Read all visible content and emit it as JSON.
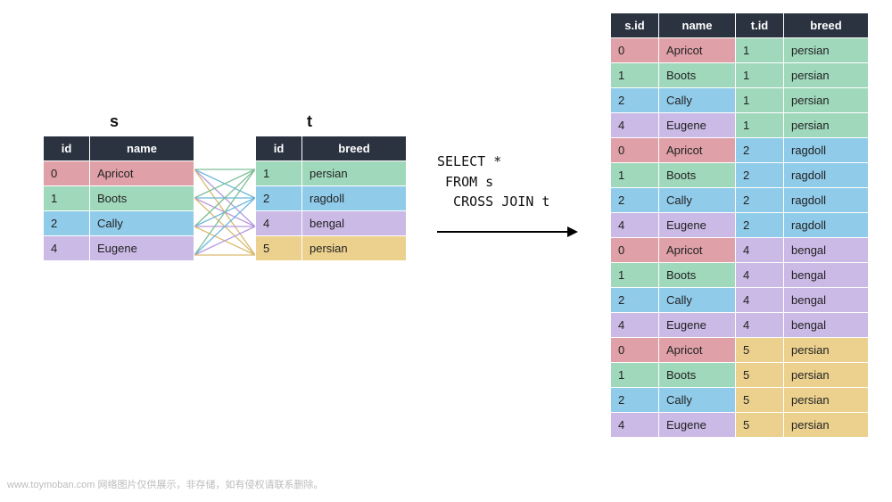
{
  "titles": {
    "s": "s",
    "t": "t"
  },
  "sql": "SELECT *\n FROM s\n  CROSS JOIN t",
  "watermark": "www.toymoban.com 网络图片仅供展示，非存储，如有侵权请联系删除。",
  "colors": {
    "header": "#2b3340",
    "red": "#dfa0a8",
    "green": "#a0d8bb",
    "blue": "#90cbea",
    "purple": "#cbb9e6",
    "yellow": "#ecd18e"
  },
  "table_s": {
    "headers": [
      "id",
      "name"
    ],
    "rows": [
      {
        "id": "0",
        "name": "Apricot",
        "color": "red"
      },
      {
        "id": "1",
        "name": "Boots",
        "color": "green"
      },
      {
        "id": "2",
        "name": "Cally",
        "color": "blue"
      },
      {
        "id": "4",
        "name": "Eugene",
        "color": "purple"
      }
    ]
  },
  "table_t": {
    "headers": [
      "id",
      "breed"
    ],
    "rows": [
      {
        "id": "1",
        "breed": "persian",
        "color": "green"
      },
      {
        "id": "2",
        "breed": "ragdoll",
        "color": "blue"
      },
      {
        "id": "4",
        "breed": "bengal",
        "color": "purple"
      },
      {
        "id": "5",
        "breed": "persian",
        "color": "yellow"
      }
    ]
  },
  "result": {
    "headers": [
      "s.id",
      "name",
      "t.id",
      "breed"
    ],
    "rows": [
      {
        "sid": "0",
        "name": "Apricot",
        "tid": "1",
        "breed": "persian",
        "scolor": "red",
        "tcolor": "green"
      },
      {
        "sid": "1",
        "name": "Boots",
        "tid": "1",
        "breed": "persian",
        "scolor": "green",
        "tcolor": "green"
      },
      {
        "sid": "2",
        "name": "Cally",
        "tid": "1",
        "breed": "persian",
        "scolor": "blue",
        "tcolor": "green"
      },
      {
        "sid": "4",
        "name": "Eugene",
        "tid": "1",
        "breed": "persian",
        "scolor": "purple",
        "tcolor": "green"
      },
      {
        "sid": "0",
        "name": "Apricot",
        "tid": "2",
        "breed": "ragdoll",
        "scolor": "red",
        "tcolor": "blue"
      },
      {
        "sid": "1",
        "name": "Boots",
        "tid": "2",
        "breed": "ragdoll",
        "scolor": "green",
        "tcolor": "blue"
      },
      {
        "sid": "2",
        "name": "Cally",
        "tid": "2",
        "breed": "ragdoll",
        "scolor": "blue",
        "tcolor": "blue"
      },
      {
        "sid": "4",
        "name": "Eugene",
        "tid": "2",
        "breed": "ragdoll",
        "scolor": "purple",
        "tcolor": "blue"
      },
      {
        "sid": "0",
        "name": "Apricot",
        "tid": "4",
        "breed": "bengal",
        "scolor": "red",
        "tcolor": "purple"
      },
      {
        "sid": "1",
        "name": "Boots",
        "tid": "4",
        "breed": "bengal",
        "scolor": "green",
        "tcolor": "purple"
      },
      {
        "sid": "2",
        "name": "Cally",
        "tid": "4",
        "breed": "bengal",
        "scolor": "blue",
        "tcolor": "purple"
      },
      {
        "sid": "4",
        "name": "Eugene",
        "tid": "4",
        "breed": "bengal",
        "scolor": "purple",
        "tcolor": "purple"
      },
      {
        "sid": "0",
        "name": "Apricot",
        "tid": "5",
        "breed": "persian",
        "scolor": "red",
        "tcolor": "yellow"
      },
      {
        "sid": "1",
        "name": "Boots",
        "tid": "5",
        "breed": "persian",
        "scolor": "green",
        "tcolor": "yellow"
      },
      {
        "sid": "2",
        "name": "Cally",
        "tid": "5",
        "breed": "persian",
        "scolor": "blue",
        "tcolor": "yellow"
      },
      {
        "sid": "4",
        "name": "Eugene",
        "tid": "5",
        "breed": "persian",
        "scolor": "purple",
        "tcolor": "yellow"
      }
    ]
  }
}
